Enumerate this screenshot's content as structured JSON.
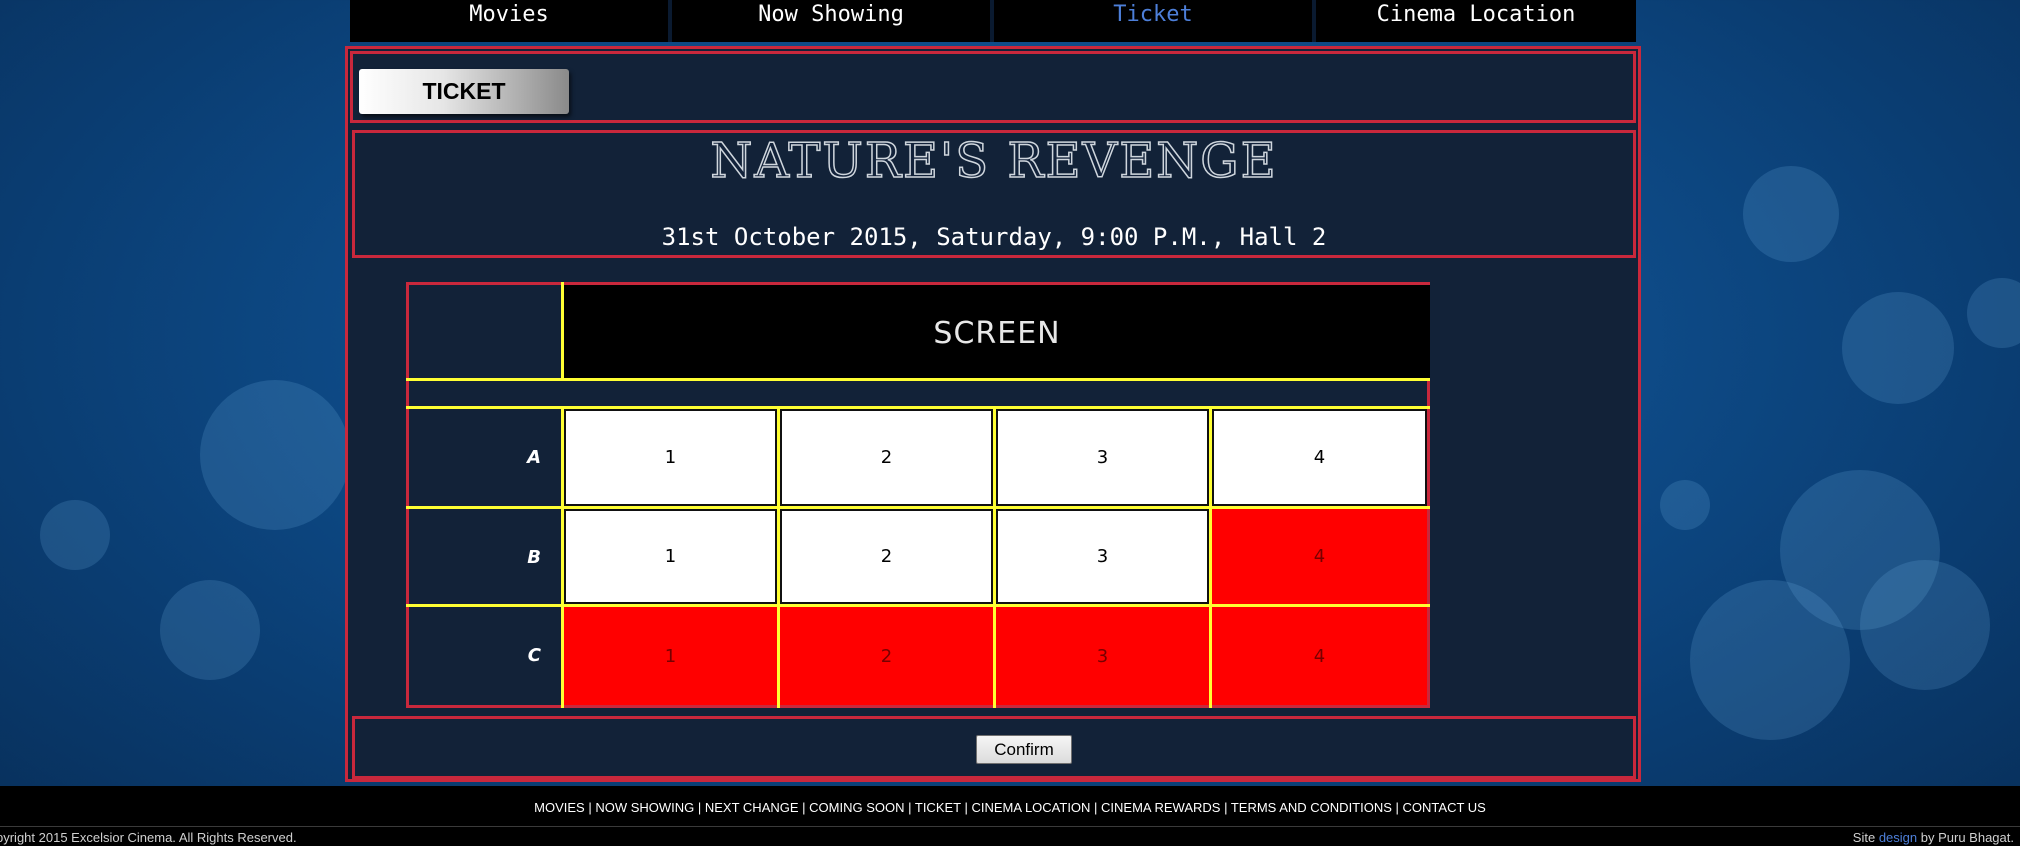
{
  "nav": {
    "items": [
      {
        "label": "Movies",
        "active": false
      },
      {
        "label": "Now Showing",
        "active": false
      },
      {
        "label": "Ticket",
        "active": true
      },
      {
        "label": "Cinema Location",
        "active": false
      }
    ]
  },
  "ticket_tab": "TICKET",
  "movie": {
    "title": "NATURE'S REVENGE",
    "showtime": "31st October 2015, Saturday, 9:00 P.M., Hall 2"
  },
  "screen_label": "SCREEN",
  "seats": {
    "rows": [
      {
        "label": "A",
        "seats": [
          {
            "number": "1",
            "status": "available"
          },
          {
            "number": "2",
            "status": "available"
          },
          {
            "number": "3",
            "status": "available"
          },
          {
            "number": "4",
            "status": "available"
          }
        ]
      },
      {
        "label": "B",
        "seats": [
          {
            "number": "1",
            "status": "available"
          },
          {
            "number": "2",
            "status": "available"
          },
          {
            "number": "3",
            "status": "available"
          },
          {
            "number": "4",
            "status": "taken"
          }
        ]
      },
      {
        "label": "C",
        "seats": [
          {
            "number": "1",
            "status": "taken"
          },
          {
            "number": "2",
            "status": "taken"
          },
          {
            "number": "3",
            "status": "taken"
          },
          {
            "number": "4",
            "status": "taken"
          }
        ]
      }
    ]
  },
  "confirm_label": "Confirm",
  "footer": {
    "links": [
      "MOVIES",
      "NOW SHOWING",
      "NEXT CHANGE",
      "COMING SOON",
      "TICKET",
      "CINEMA LOCATION",
      "CINEMA REWARDS",
      "TERMS AND CONDITIONS",
      "CONTACT US"
    ],
    "copyright": "pyright 2015 Excelsior Cinema. All Rights Reserved.",
    "credit_prefix": "Site",
    "credit_link": "design",
    "credit_suffix": "by Puru Bhagat."
  },
  "colors": {
    "accent_red": "#c9283c",
    "grid_yellow": "#ffff33",
    "taken_seat": "#ff0000",
    "active_nav": "#4d7fd9"
  }
}
